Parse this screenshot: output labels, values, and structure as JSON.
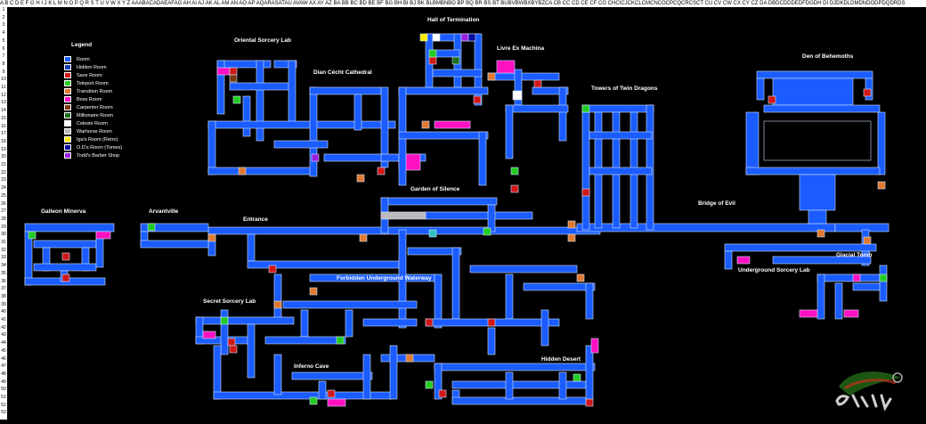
{
  "column_header": "A B C D E F G H I J K L M N O P Q R S T U V W X Y Z AAABACADAEAFAG AH AI AJ AK AL AM AN AO AP AQARASATAU AVAW AX AY AZ BA BB BC BD BE BF BG BH BI BJ BK BLBMBNBO BP BQ BR BS BT BUBVBWBXBYBZCA CB CC CD CE CF CG CHCICJCKCLCMCNCOCPCQCRCSCT CU CV CW CX CY CZ DA DBDCDDDEDFDGDH DI DJDKDLDMDNDODPDQDRDS",
  "row_labels": [
    "1",
    "2",
    "3",
    "4",
    "5",
    "6",
    "7",
    "8",
    "9",
    "10",
    "11",
    "12",
    "13",
    "14",
    "15",
    "16",
    "17",
    "18",
    "19",
    "20",
    "21",
    "22",
    "23",
    "24",
    "25",
    "26",
    "27",
    "28",
    "29",
    "30",
    "31",
    "32",
    "33",
    "34",
    "35",
    "36",
    "37",
    "38",
    "39",
    "40",
    "41",
    "42",
    "43",
    "44",
    "45",
    "46",
    "47",
    "48",
    "49",
    "50",
    "51",
    "52",
    "53"
  ],
  "legend": {
    "title": "Legend",
    "items": [
      {
        "label": "Room",
        "color": "#1a5cff"
      },
      {
        "label": "Hidden Room",
        "color": "#1a3fb0"
      },
      {
        "label": "Save Room",
        "color": "#d01818"
      },
      {
        "label": "Teleport Room",
        "color": "#22cc22"
      },
      {
        "label": "Transition Room",
        "color": "#e07a30"
      },
      {
        "label": "Boss Room",
        "color": "#ff10c0"
      },
      {
        "label": "Carpenter Room",
        "color": "#7a3a10"
      },
      {
        "label": "Millionaire Room",
        "color": "#1e6e1e"
      },
      {
        "label": "Celeste Room",
        "color": "#ffffff"
      },
      {
        "label": "Warhorse Room",
        "color": "#bbbbbb"
      },
      {
        "label": "Iga's Room (Retro)",
        "color": "#ffee00"
      },
      {
        "label": "O.D's Room (Tomes)",
        "color": "#0a0aa0"
      },
      {
        "label": "Todd's Barber Shop",
        "color": "#9a20e0"
      }
    ]
  },
  "areas": [
    {
      "label": "Hall of Termination"
    },
    {
      "label": "Oriental Sorcery Lab"
    },
    {
      "label": "Livre Ex Machina"
    },
    {
      "label": "Dian Cécht Cathedral"
    },
    {
      "label": "Den of Behemoths"
    },
    {
      "label": "Towers of Twin Dragons"
    },
    {
      "label": "Garden of Silence"
    },
    {
      "label": "Bridge of Evil"
    },
    {
      "label": "Galleon Minerva"
    },
    {
      "label": "Arvantville"
    },
    {
      "label": "Entrance"
    },
    {
      "label": "Forbidden Underground Waterway"
    },
    {
      "label": "Glacial Tomb"
    },
    {
      "label": "Underground Sorcery Lab"
    },
    {
      "label": "Secret Sorcery Lab"
    },
    {
      "label": "Inferno Cave"
    },
    {
      "label": "Hidden Desert"
    }
  ],
  "colors": {
    "room": "#1a5cff",
    "room_border": "#cfe0ff",
    "background": "#000000"
  }
}
